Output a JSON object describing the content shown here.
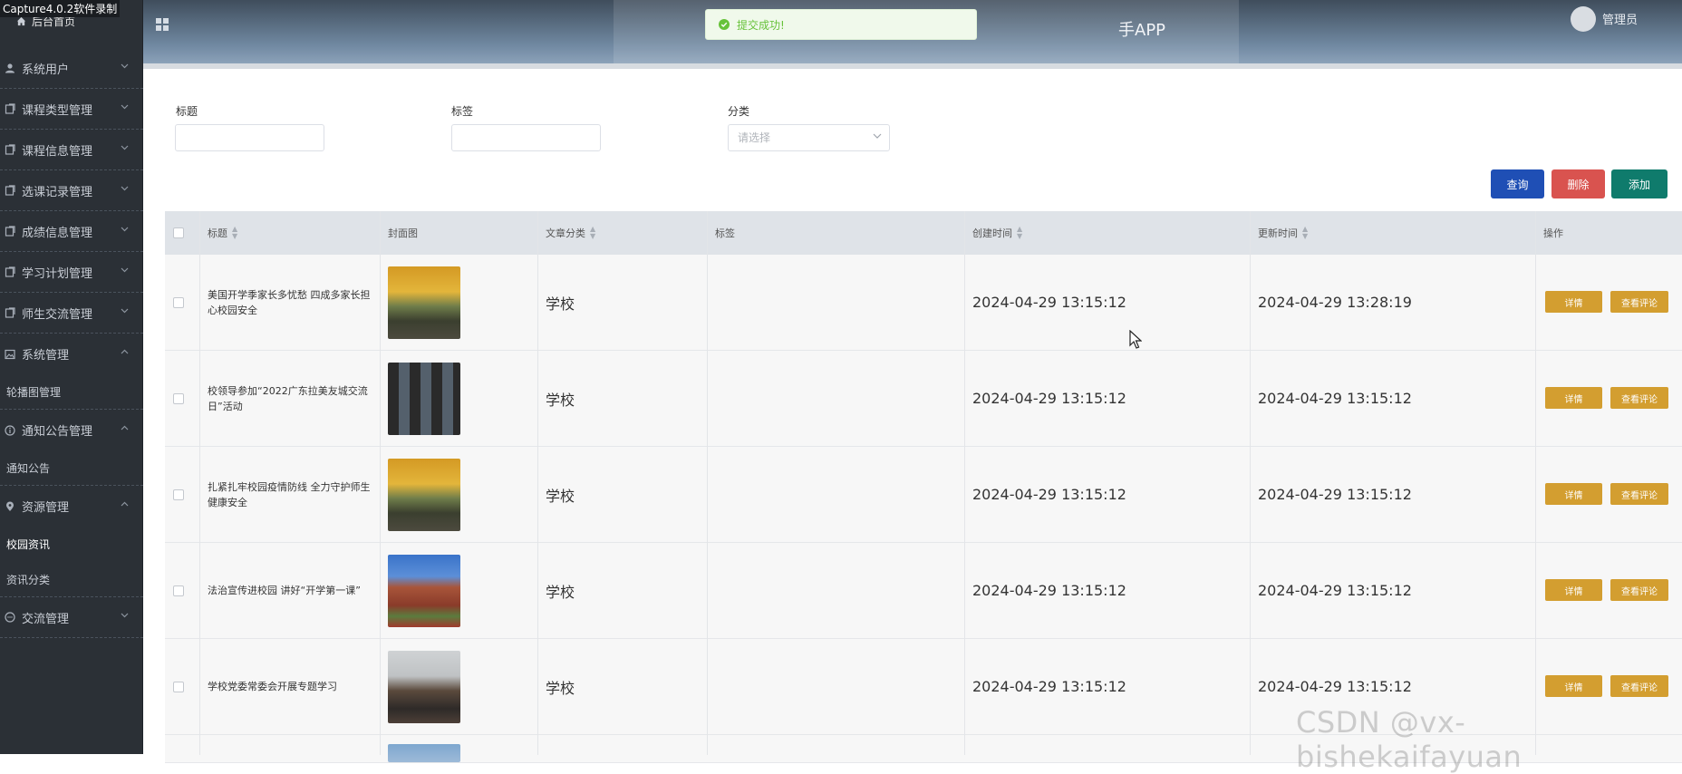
{
  "capture_banner": "Capture4.0.2软件录制",
  "sidebar": {
    "home": "后台首页",
    "groups": [
      {
        "label": "系统用户",
        "icon": "user-icon",
        "expanded": false
      },
      {
        "label": "课程类型管理",
        "icon": "document-icon",
        "expanded": false
      },
      {
        "label": "课程信息管理",
        "icon": "document-icon",
        "expanded": false
      },
      {
        "label": "选课记录管理",
        "icon": "document-icon",
        "expanded": false
      },
      {
        "label": "成绩信息管理",
        "icon": "document-icon",
        "expanded": false
      },
      {
        "label": "学习计划管理",
        "icon": "document-icon",
        "expanded": false
      },
      {
        "label": "师生交流管理",
        "icon": "document-icon",
        "expanded": false
      },
      {
        "label": "系统管理",
        "icon": "image-icon",
        "expanded": true,
        "children": [
          "轮播图管理"
        ]
      },
      {
        "label": "通知公告管理",
        "icon": "info-icon",
        "expanded": true,
        "children": [
          "通知公告"
        ]
      },
      {
        "label": "资源管理",
        "icon": "location-icon",
        "expanded": true,
        "children": [
          "校园资讯",
          "资讯分类"
        ],
        "active_child": "校园资讯"
      },
      {
        "label": "交流管理",
        "icon": "chat-icon",
        "expanded": false
      }
    ]
  },
  "header": {
    "title": "手APP",
    "admin": "管理员"
  },
  "toast": {
    "message": "提交成功!",
    "color": "#67c23a"
  },
  "filters": {
    "title_label": "标题",
    "tag_label": "标签",
    "category_label": "分类",
    "category_placeholder": "请选择"
  },
  "actions": {
    "query": "查询",
    "delete": "删除",
    "add": "添加",
    "query_color": "#1f4fb5",
    "delete_color": "#d9534f",
    "add_color": "#0f7b6c"
  },
  "table": {
    "columns": [
      "标题",
      "封面图",
      "文章分类",
      "标签",
      "创建时间",
      "更新时间",
      "操作"
    ],
    "detail_label": "详情",
    "comment_label": "查看评论",
    "rows": [
      {
        "title": "美国开学季家长多忧愁 四成多家长担心校园安全",
        "category": "学校",
        "tag": "",
        "created": "2024-04-29 13:15:12",
        "updated": "2024-04-29 13:28:19",
        "cover": "autumn-campus"
      },
      {
        "title": "校领导参加“2022广东拉美友城交流日”活动",
        "category": "学校",
        "tag": "",
        "created": "2024-04-29 13:15:12",
        "updated": "2024-04-29 13:15:12",
        "cover": "video-conference"
      },
      {
        "title": "扎紧扎牢校园疫情防线 全力守护师生健康安全",
        "category": "学校",
        "tag": "",
        "created": "2024-04-29 13:15:12",
        "updated": "2024-04-29 13:15:12",
        "cover": "autumn-campus"
      },
      {
        "title": "法治宣传进校园 讲好“开学第一课”",
        "category": "学校",
        "tag": "",
        "created": "2024-04-29 13:15:12",
        "updated": "2024-04-29 13:15:12",
        "cover": "red-building"
      },
      {
        "title": "学校党委常委会开展专题学习",
        "category": "学校",
        "tag": "",
        "created": "2024-04-29 13:15:12",
        "updated": "2024-04-29 13:15:12",
        "cover": "meeting-room"
      }
    ]
  },
  "watermark": "CSDN @vx-bishekaifayuan"
}
